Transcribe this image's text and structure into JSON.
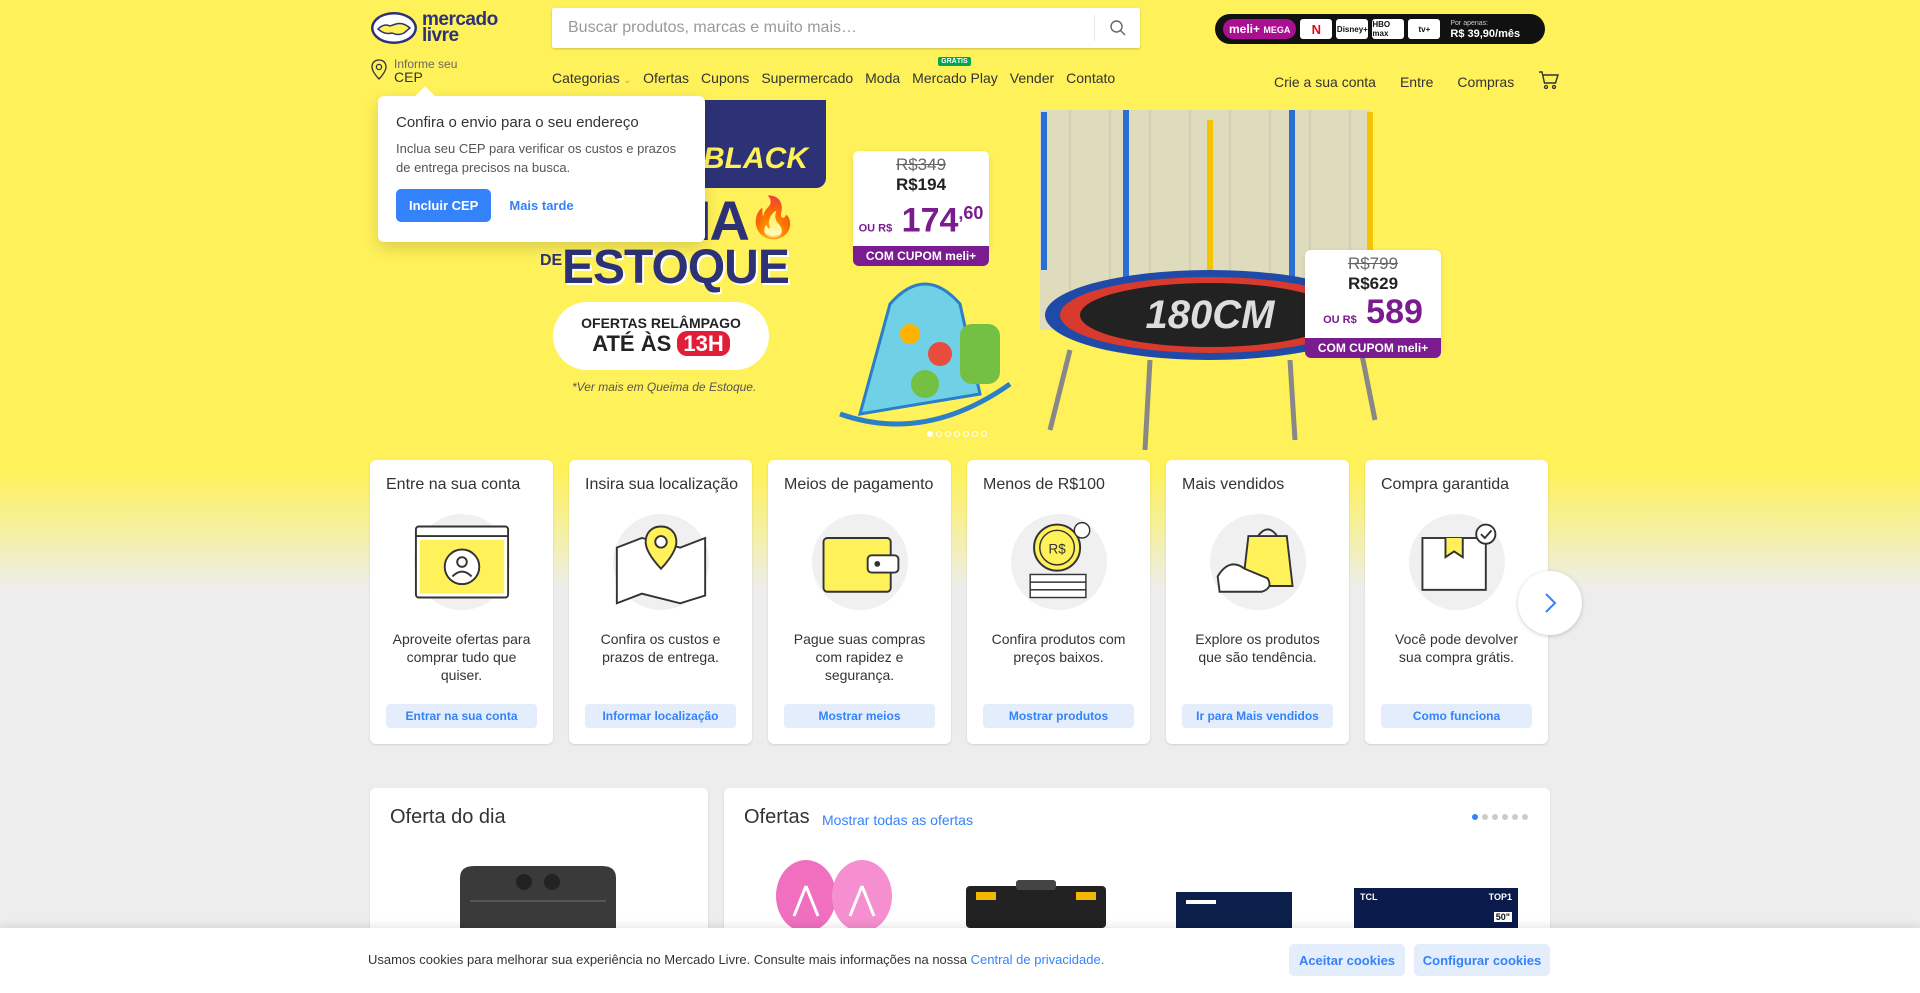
{
  "header": {
    "logo_text_1": "mercado",
    "logo_text_2": "livre",
    "search": {
      "placeholder": "Buscar produtos, marcas e muito mais…"
    },
    "meli": {
      "pill": "meli+",
      "pill_suffix": "MEGA",
      "services": [
        "N",
        "Disney+",
        "HBO max",
        "tv+"
      ],
      "price_small": "Por apenas:",
      "price": "R$ 39,90/mês"
    },
    "cep": {
      "label": "Informe seu",
      "value": "CEP"
    },
    "nav": {
      "categorias": "Categorias",
      "ofertas": "Ofertas",
      "cupons": "Cupons",
      "supermercado": "Supermercado",
      "moda": "Moda",
      "mercado_play": "Mercado Play",
      "gratis_badge": "GRÁTIS",
      "vender": "Vender",
      "contato": "Contato"
    },
    "account": {
      "create": "Crie a sua conta",
      "login": "Entre",
      "purchases": "Compras"
    }
  },
  "popover": {
    "title": "Confira o envio para o seu endereço",
    "text": "Inclua seu CEP para verificar os custos e prazos de entrega precisos na busca.",
    "primary": "Incluir CEP",
    "secondary": "Mais tarde"
  },
  "hero": {
    "black": "BLACK",
    "queima": "IA",
    "de": "DE",
    "estoque": "ESTOQUE",
    "flash_l1": "OFERTAS RELÂMPAGO",
    "flash_l2_pre": "ATÉ ÀS",
    "flash_l2_time": "13H",
    "note": "*Ver mais em Queima de Estoque.",
    "tag1": {
      "old": "R$349",
      "mid": "R$194",
      "ou": "OU R$",
      "new": "174",
      "cents": ",60",
      "cupom": "COM CUPOM meli+"
    },
    "tag2": {
      "old": "R$799",
      "mid": "R$629",
      "ou": "OU R$",
      "new": "589",
      "cupom": "COM CUPOM meli+"
    },
    "tramp_label": "180CM",
    "slides": 7,
    "active_slide": 1
  },
  "cards": [
    {
      "title": "Entre na sua conta",
      "desc": "Aproveite ofertas para comprar tudo que quiser.",
      "button": "Entrar na sua conta"
    },
    {
      "title": "Insira sua localização",
      "desc": "Confira os custos e prazos de entrega.",
      "button": "Informar localização"
    },
    {
      "title": "Meios de pagamento",
      "desc": "Pague suas compras com rapidez e segurança.",
      "button": "Mostrar meios"
    },
    {
      "title": "Menos de R$100",
      "desc": "Confira produtos com preços baixos.",
      "button": "Mostrar produtos"
    },
    {
      "title": "Mais vendidos",
      "desc": "Explore os produtos que são tendência.",
      "button": "Ir para Mais vendidos"
    },
    {
      "title": "Compra garantida",
      "desc": "Você pode devolver sua compra grátis.",
      "button": "Como funciona"
    }
  ],
  "deal": {
    "title": "Oferta do dia"
  },
  "offers": {
    "title": "Ofertas",
    "link": "Mostrar todas as ofertas",
    "pages": 6,
    "active_page": 1,
    "tv_brand": "TCL",
    "tv_badge": "TOP1",
    "tv_size": "50\""
  },
  "cookie": {
    "text": "Usamos cookies para melhorar sua experiência no Mercado Livre. Consulte mais informações na nossa",
    "link": "Central de privacidade.",
    "accept": "Aceitar cookies",
    "configure": "Configurar cookies"
  },
  "colors": {
    "brand_yellow": "#fff159",
    "brand_blue": "#3483fa",
    "navy": "#2d3277",
    "purple": "#7a1b8f"
  }
}
